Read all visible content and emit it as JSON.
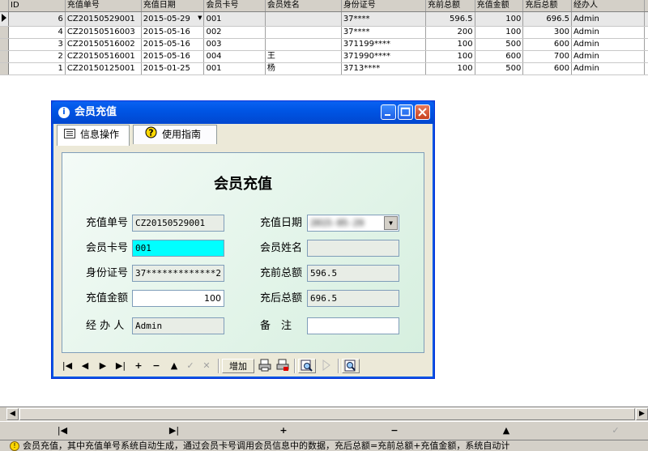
{
  "grid": {
    "columns": [
      "ID",
      "充值单号",
      "充值日期",
      "会员卡号",
      "会员姓名",
      "身份证号",
      "充前总额",
      "充值金额",
      "充后总额",
      "经办人"
    ],
    "rows": [
      {
        "id": "6",
        "no": "CZ20150529001",
        "date": "2015-05-29",
        "card": "001",
        "name": "",
        "idcard": "37****",
        "before": "596.5",
        "amount": "100",
        "after": "696.5",
        "op": "Admin",
        "selected": true
      },
      {
        "id": "4",
        "no": "CZ20150516003",
        "date": "2015-05-16",
        "card": "002",
        "name": "",
        "idcard": "37****",
        "before": "200",
        "amount": "100",
        "after": "300",
        "op": "Admin",
        "selected": false
      },
      {
        "id": "3",
        "no": "CZ20150516002",
        "date": "2015-05-16",
        "card": "003",
        "name": "",
        "idcard": "371199****",
        "before": "100",
        "amount": "500",
        "after": "600",
        "op": "Admin",
        "selected": false
      },
      {
        "id": "2",
        "no": "CZ20150516001",
        "date": "2015-05-16",
        "card": "004",
        "name": "王",
        "idcard": "371990****",
        "before": "100",
        "amount": "600",
        "after": "700",
        "op": "Admin",
        "selected": false
      },
      {
        "id": "1",
        "no": "CZ20150125001",
        "date": "2015-01-25",
        "card": "001",
        "name": "杨",
        "idcard": "3713****",
        "before": "100",
        "amount": "500",
        "after": "600",
        "op": "Admin",
        "selected": false
      }
    ]
  },
  "dialog": {
    "title": "会员充值",
    "tabs": [
      {
        "label": "信息操作"
      },
      {
        "label": "使用指南"
      }
    ],
    "form": {
      "title": "会员充值",
      "recharge_no_label": "充值单号",
      "recharge_no": "CZ20150529001",
      "recharge_date_label": "充值日期",
      "recharge_date": "2015-05-29",
      "card_no_label": "会员卡号",
      "card_no": "001",
      "member_name_label": "会员姓名",
      "member_name": "",
      "id_card_label": "身份证号",
      "id_card": "37*************2",
      "before_total_label": "充前总额",
      "before_total": "596.5",
      "amount_label": "充值金额",
      "amount": "100",
      "after_total_label": "充后总额",
      "after_total": "696.5",
      "operator_label": "经 办 人",
      "operator": "Admin",
      "remark_label": "备　注",
      "remark": ""
    },
    "toolbar": {
      "add_label": "增加"
    }
  },
  "status": {
    "text": "会员充值，其中充值单号系统自动生成，通过会员卡号调用会员信息中的数据，充后总额=充前总额+充值金额，系统自动计"
  }
}
